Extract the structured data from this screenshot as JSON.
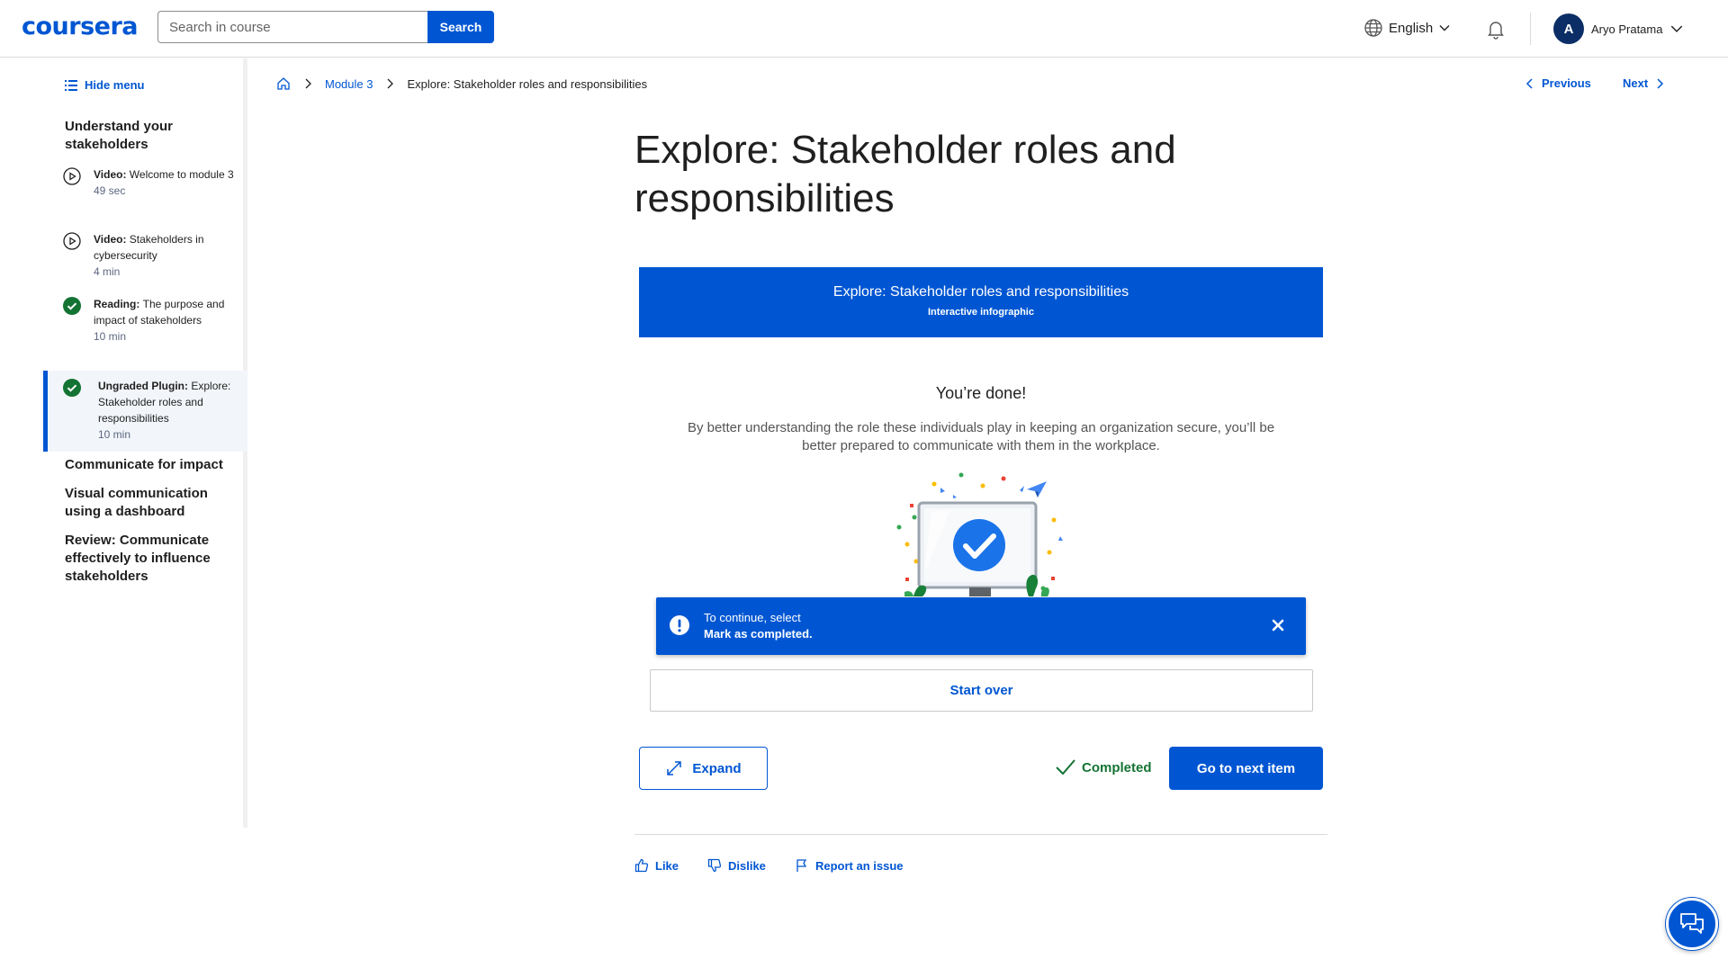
{
  "header": {
    "logo": "coursera",
    "search_placeholder": "Search in course",
    "search_button": "Search",
    "language": "English",
    "user_initial": "A",
    "user_name": "Aryo Pratama"
  },
  "sidebar": {
    "hide_menu": "Hide menu",
    "sections": [
      {
        "title": "Understand your stakeholders",
        "items": [
          {
            "type": "Video:",
            "title": "Welcome to module 3",
            "duration": "49 sec",
            "status": "video"
          },
          {
            "type": "Video:",
            "title": "Stakeholders in cybersecurity",
            "duration": "4 min",
            "status": "video"
          },
          {
            "type": "Reading:",
            "title": "The purpose and impact of stakeholders",
            "duration": "10 min",
            "status": "completed"
          },
          {
            "type": "Ungraded Plugin:",
            "title": "Explore: Stakeholder roles and responsibilities",
            "duration": "10 min",
            "status": "completed-active"
          }
        ]
      },
      {
        "title": "Communicate for impact"
      },
      {
        "title": "Visual communication using a dashboard"
      },
      {
        "title": "Review: Communicate effectively to influence stakeholders"
      }
    ]
  },
  "breadcrumb": {
    "module": "Module 3",
    "current": "Explore: Stakeholder roles and responsibilities"
  },
  "nav": {
    "previous": "Previous",
    "next": "Next"
  },
  "main": {
    "title": "Explore: Stakeholder roles and responsibilities",
    "banner_title": "Explore: Stakeholder roles and responsibilities",
    "banner_subtitle": "Interactive infographic",
    "done_title": "You’re done!",
    "done_desc": "By better understanding the role these individuals play in keeping an organization secure, you’ll be better prepared to communicate with them in the workplace.",
    "toast_line1": "To continue, select",
    "toast_line2": "Mark as completed.",
    "start_over": "Start over",
    "expand": "Expand",
    "completed": "Completed",
    "next_item": "Go to next item"
  },
  "feedback": {
    "like": "Like",
    "dislike": "Dislike",
    "report": "Report an issue"
  },
  "colors": {
    "brand": "#0056d2",
    "success": "#137333",
    "navy": "#0b2e66"
  }
}
